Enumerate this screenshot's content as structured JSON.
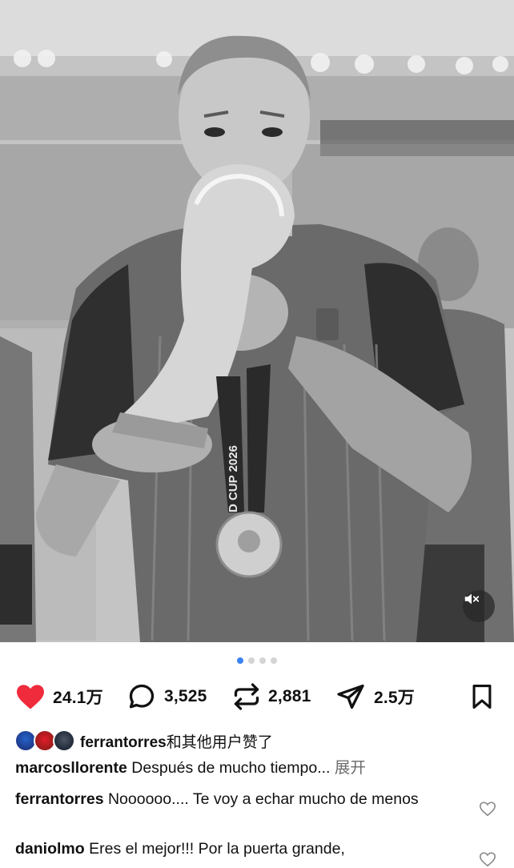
{
  "photo": {
    "description_icon": "player-trophy-photo",
    "medal_text": "D CUP 2026"
  },
  "mute": {
    "icon": "speaker-muted-icon"
  },
  "carousel": {
    "dots": 4,
    "active": 1,
    "active_color": "#3b82f6"
  },
  "actions": {
    "like_count": "24.1万",
    "comment_count": "3,525",
    "repost_count": "2,881",
    "share_count": "2.5万",
    "like_color": "#ef2b3c"
  },
  "likes": {
    "username": "ferrantorres",
    "suffix": "和其他用户赞了"
  },
  "caption": {
    "username": "marcosllorente",
    "text": "Después de mucho tiempo...",
    "expand": "展开"
  },
  "comments": [
    {
      "username": "ferrantorres",
      "text": "Noooooo.... Te voy a echar mucho de menos"
    },
    {
      "username": "daniolmo",
      "text": "Eres el mejor!!! Por la puerta grande,"
    }
  ]
}
